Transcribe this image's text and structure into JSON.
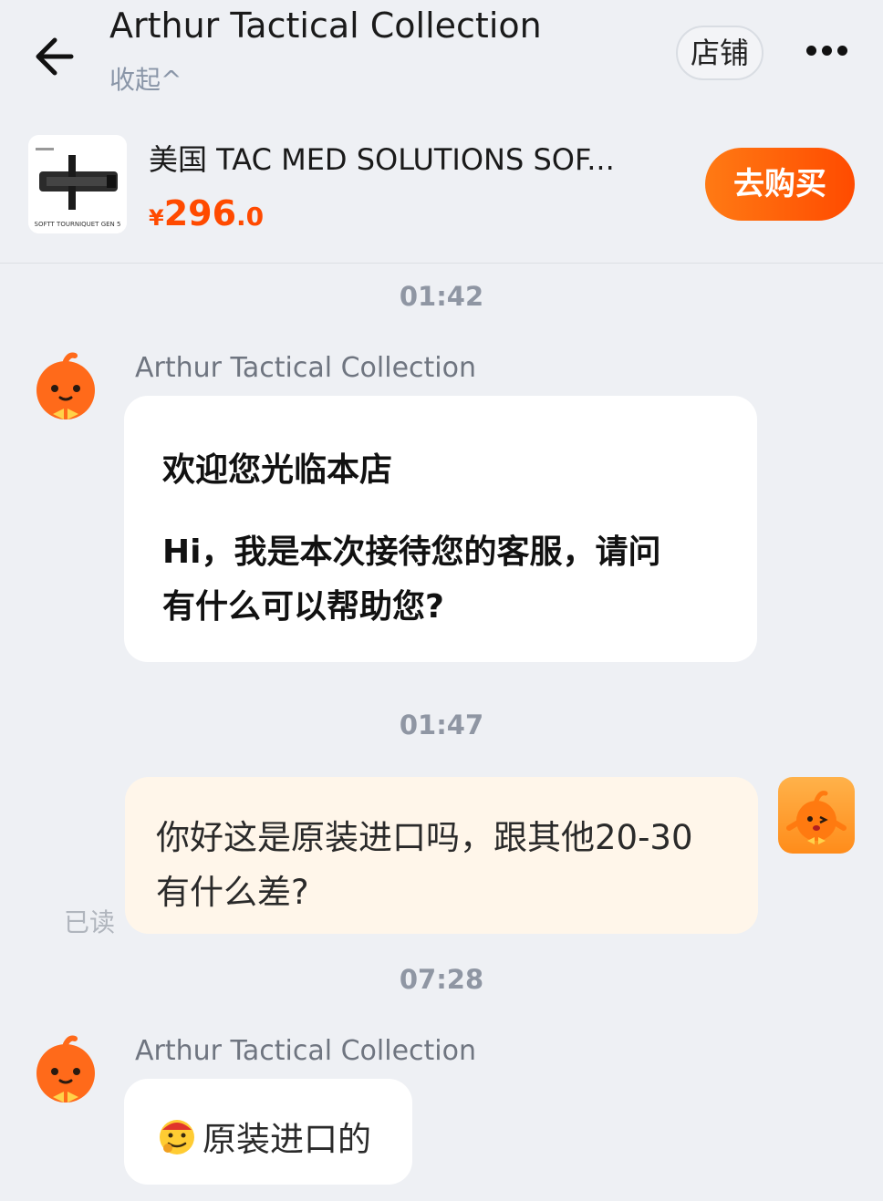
{
  "header": {
    "title": "Arthur Tactical Collection",
    "collapse_label": "收起^",
    "store_label": "店铺"
  },
  "product": {
    "name": "美国 TAC MED SOLUTIONS SOF...",
    "price_currency": "¥",
    "price_int": "296",
    "price_dec": ".0",
    "buy_label": "去购买",
    "thumb_caption": "SOFTT TOURNIQUET GEN 5"
  },
  "messages": [
    {
      "time": "01:42",
      "sender": "Arthur Tactical Collection",
      "lines": [
        "欢迎您光临本店",
        "Hi，我是本次接待您的客服，请问",
        "有什么可以帮助您?"
      ]
    },
    {
      "time": "01:47",
      "lines": [
        "你好这是原装进口吗，跟其他20-30",
        "有什么差?"
      ],
      "status": "已读"
    },
    {
      "time": "07:28",
      "sender": "Arthur Tactical Collection",
      "text": "原装进口的"
    }
  ],
  "colors": {
    "accent": "#ff5a00",
    "background": "#eef0f4",
    "outgoing_bubble": "#fff6ea"
  },
  "icons": {
    "back": "arrow-left-icon",
    "more": "more-dots-icon",
    "emoji": "thinking-face-icon"
  }
}
